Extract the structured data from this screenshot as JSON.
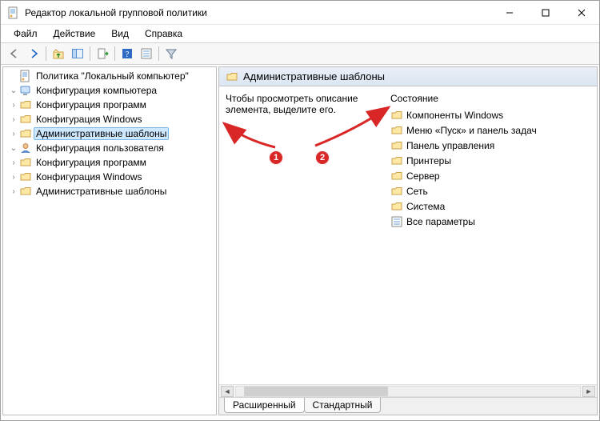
{
  "window": {
    "title": "Редактор локальной групповой политики"
  },
  "menu": {
    "file": "Файл",
    "action": "Действие",
    "view": "Вид",
    "help": "Справка"
  },
  "tree": {
    "root": "Политика \"Локальный компьютер\"",
    "comp_cfg": "Конфигурация компьютера",
    "comp_sw": "Конфигурация программ",
    "comp_win": "Конфигурация Windows",
    "comp_adm": "Административные шаблоны",
    "user_cfg": "Конфигурация пользователя",
    "user_sw": "Конфигурация программ",
    "user_win": "Конфигурация Windows",
    "user_adm": "Административные шаблоны"
  },
  "right": {
    "header": "Административные шаблоны",
    "desc": "Чтобы просмотреть описание элемента, выделите его.",
    "col_state": "Состояние",
    "items": {
      "i0": "Компоненты Windows",
      "i1": "Меню «Пуск» и панель задач",
      "i2": "Панель управления",
      "i3": "Принтеры",
      "i4": "Сервер",
      "i5": "Сеть",
      "i6": "Система",
      "i7": "Все параметры"
    }
  },
  "tabs": {
    "ext": "Расширенный",
    "std": "Стандартный"
  },
  "annotations": {
    "b1": "1",
    "b2": "2"
  }
}
